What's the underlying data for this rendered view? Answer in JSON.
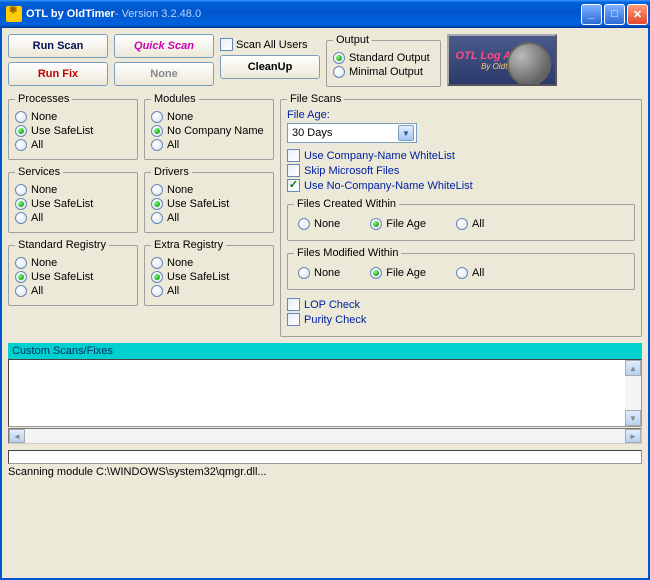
{
  "title": {
    "app": "OTL by OldTimer",
    "version": " - Version 3.2.48.0"
  },
  "buttons": {
    "run_scan": "Run Scan",
    "quick_scan": "Quick Scan",
    "run_fix": "Run Fix",
    "none": "None",
    "cleanup": "CleanUp"
  },
  "scan_all_users": "Scan All Users",
  "output": {
    "legend": "Output",
    "standard": "Standard Output",
    "minimal": "Minimal Output"
  },
  "logo": {
    "l1": "OTL Log Analysis",
    "l2": "By Oldtimer"
  },
  "groups": {
    "processes": {
      "legend": "Processes",
      "none": "None",
      "safelist": "Use SafeList",
      "all": "All"
    },
    "modules": {
      "legend": "Modules",
      "none": "None",
      "nocompany": "No Company Name",
      "all": "All"
    },
    "services": {
      "legend": "Services",
      "none": "None",
      "safelist": "Use SafeList",
      "all": "All"
    },
    "drivers": {
      "legend": "Drivers",
      "none": "None",
      "safelist": "Use SafeList",
      "all": "All"
    },
    "stdreg": {
      "legend": "Standard Registry",
      "none": "None",
      "safelist": "Use SafeList",
      "all": "All"
    },
    "extrareg": {
      "legend": "Extra Registry",
      "none": "None",
      "safelist": "Use SafeList",
      "all": "All"
    }
  },
  "filescans": {
    "legend": "File Scans",
    "file_age_label": "File Age:",
    "file_age_value": "30 Days",
    "whitelist": "Use Company-Name WhiteList",
    "skip_ms": "Skip Microsoft Files",
    "nocompany_wl": "Use No-Company-Name WhiteList",
    "created": {
      "legend": "Files Created Within",
      "none": "None",
      "fileage": "File Age",
      "all": "All"
    },
    "modified": {
      "legend": "Files Modified Within",
      "none": "None",
      "fileage": "File Age",
      "all": "All"
    },
    "lop": "LOP Check",
    "purity": "Purity Check"
  },
  "custom": "Custom Scans/Fixes",
  "status": "Scanning module C:\\WINDOWS\\system32\\qmgr.dll..."
}
